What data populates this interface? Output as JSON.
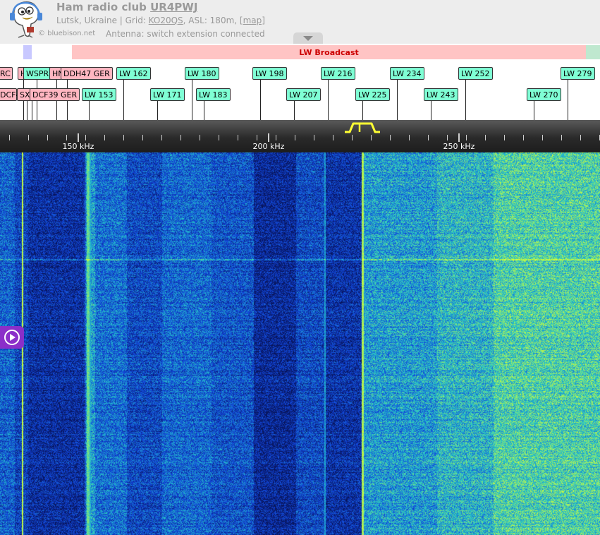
{
  "header": {
    "title_prefix": "Ham radio club ",
    "callsign": "UR4PWJ",
    "location_text": "Lutsk, Ukraine | Grid: ",
    "grid": "KO20QS",
    "asl_text": ", ASL: 180m, ",
    "map_link": "[map]",
    "credit": "© bluebison.net",
    "antenna": "Antenna: switch extension connected"
  },
  "bands": [
    {
      "name": "LW Broadcast",
      "color": "#ffc4c4"
    }
  ],
  "band_colors": {
    "left_marker": "#c8c8ff",
    "right_marker": "#bfe8cf"
  },
  "scale": {
    "labels": [
      "150 kHz",
      "200 kHz",
      "250 kHz"
    ]
  },
  "stations": [
    {
      "id": "rc",
      "label": "RC",
      "color": "pink",
      "row": 1
    },
    {
      "id": "h",
      "label": "H",
      "color": "pink",
      "row": 1
    },
    {
      "id": "wspr",
      "label": "WSPR",
      "color": "green",
      "row": 1
    },
    {
      "id": "hn",
      "label": "HN",
      "color": "pink",
      "row": 1
    },
    {
      "id": "ddh47",
      "label": "DDH47 GER",
      "color": "pink",
      "row": 1
    },
    {
      "id": "lw162",
      "label": "LW 162",
      "color": "green",
      "row": 1
    },
    {
      "id": "lw180",
      "label": "LW 180",
      "color": "green",
      "row": 1
    },
    {
      "id": "lw198",
      "label": "LW 198",
      "color": "green",
      "row": 1
    },
    {
      "id": "lw216",
      "label": "LW 216",
      "color": "green",
      "row": 1
    },
    {
      "id": "lw234",
      "label": "LW 234",
      "color": "green",
      "row": 1
    },
    {
      "id": "lw252",
      "label": "LW 252",
      "color": "green",
      "row": 1
    },
    {
      "id": "lw279",
      "label": "LW 279",
      "color": "green",
      "row": 1
    },
    {
      "id": "dcf4",
      "label": "DCF4",
      "color": "pink",
      "row": 2
    },
    {
      "id": "sx",
      "label": "SX",
      "color": "pink",
      "row": 2
    },
    {
      "id": "dcf39",
      "label": "DCF39 GER",
      "color": "pink",
      "row": 2
    },
    {
      "id": "lw153",
      "label": "LW 153",
      "color": "green",
      "row": 2
    },
    {
      "id": "lw171",
      "label": "LW 171",
      "color": "green",
      "row": 2
    },
    {
      "id": "lw183",
      "label": "LW 183",
      "color": "green",
      "row": 2
    },
    {
      "id": "lw207",
      "label": "LW 207",
      "color": "green",
      "row": 2
    },
    {
      "id": "lw225",
      "label": "LW 225",
      "color": "green",
      "row": 2
    },
    {
      "id": "lw243",
      "label": "LW 243",
      "color": "green",
      "row": 2
    },
    {
      "id": "lw270",
      "label": "LW 270",
      "color": "green",
      "row": 2
    }
  ],
  "passband_color": "#ffff33",
  "waterfall_colors": {
    "dark": "#0a1a6e",
    "mid": "#1f5ad8",
    "bright": "#2ad4c8",
    "peak": "#d8ff3a"
  },
  "play_button_color": "#8b2fc9"
}
